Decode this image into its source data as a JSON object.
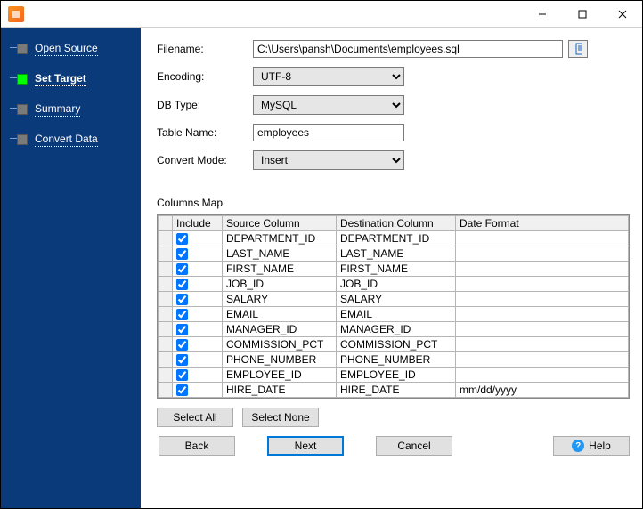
{
  "titlebar": {
    "min": "—",
    "max": "☐",
    "close": "✕"
  },
  "sidebar": {
    "items": [
      {
        "label": "Open Source",
        "active": false
      },
      {
        "label": "Set Target",
        "active": true
      },
      {
        "label": "Summary",
        "active": false
      },
      {
        "label": "Convert Data",
        "active": false
      }
    ]
  },
  "form": {
    "filename_label": "Filename:",
    "filename_value": "C:\\Users\\pansh\\Documents\\employees.sql",
    "encoding_label": "Encoding:",
    "encoding_value": "UTF-8",
    "dbtype_label": "DB Type:",
    "dbtype_value": "MySQL",
    "tablename_label": "Table Name:",
    "tablename_value": "employees",
    "convertmode_label": "Convert Mode:",
    "convertmode_value": "Insert"
  },
  "columns_map": {
    "title": "Columns Map",
    "headers": {
      "include": "Include",
      "source": "Source Column",
      "dest": "Destination Column",
      "fmt": "Date Format"
    },
    "rows": [
      {
        "inc": true,
        "src": "DEPARTMENT_ID",
        "dst": "DEPARTMENT_ID",
        "fmt": ""
      },
      {
        "inc": true,
        "src": "LAST_NAME",
        "dst": "LAST_NAME",
        "fmt": ""
      },
      {
        "inc": true,
        "src": "FIRST_NAME",
        "dst": "FIRST_NAME",
        "fmt": ""
      },
      {
        "inc": true,
        "src": "JOB_ID",
        "dst": "JOB_ID",
        "fmt": ""
      },
      {
        "inc": true,
        "src": "SALARY",
        "dst": "SALARY",
        "fmt": ""
      },
      {
        "inc": true,
        "src": "EMAIL",
        "dst": "EMAIL",
        "fmt": ""
      },
      {
        "inc": true,
        "src": "MANAGER_ID",
        "dst": "MANAGER_ID",
        "fmt": ""
      },
      {
        "inc": true,
        "src": "COMMISSION_PCT",
        "dst": "COMMISSION_PCT",
        "fmt": ""
      },
      {
        "inc": true,
        "src": "PHONE_NUMBER",
        "dst": "PHONE_NUMBER",
        "fmt": ""
      },
      {
        "inc": true,
        "src": "EMPLOYEE_ID",
        "dst": "EMPLOYEE_ID",
        "fmt": ""
      },
      {
        "inc": true,
        "src": "HIRE_DATE",
        "dst": "HIRE_DATE",
        "fmt": "mm/dd/yyyy"
      }
    ]
  },
  "buttons": {
    "select_all": "Select All",
    "select_none": "Select None",
    "back": "Back",
    "next": "Next",
    "cancel": "Cancel",
    "help": "Help"
  }
}
